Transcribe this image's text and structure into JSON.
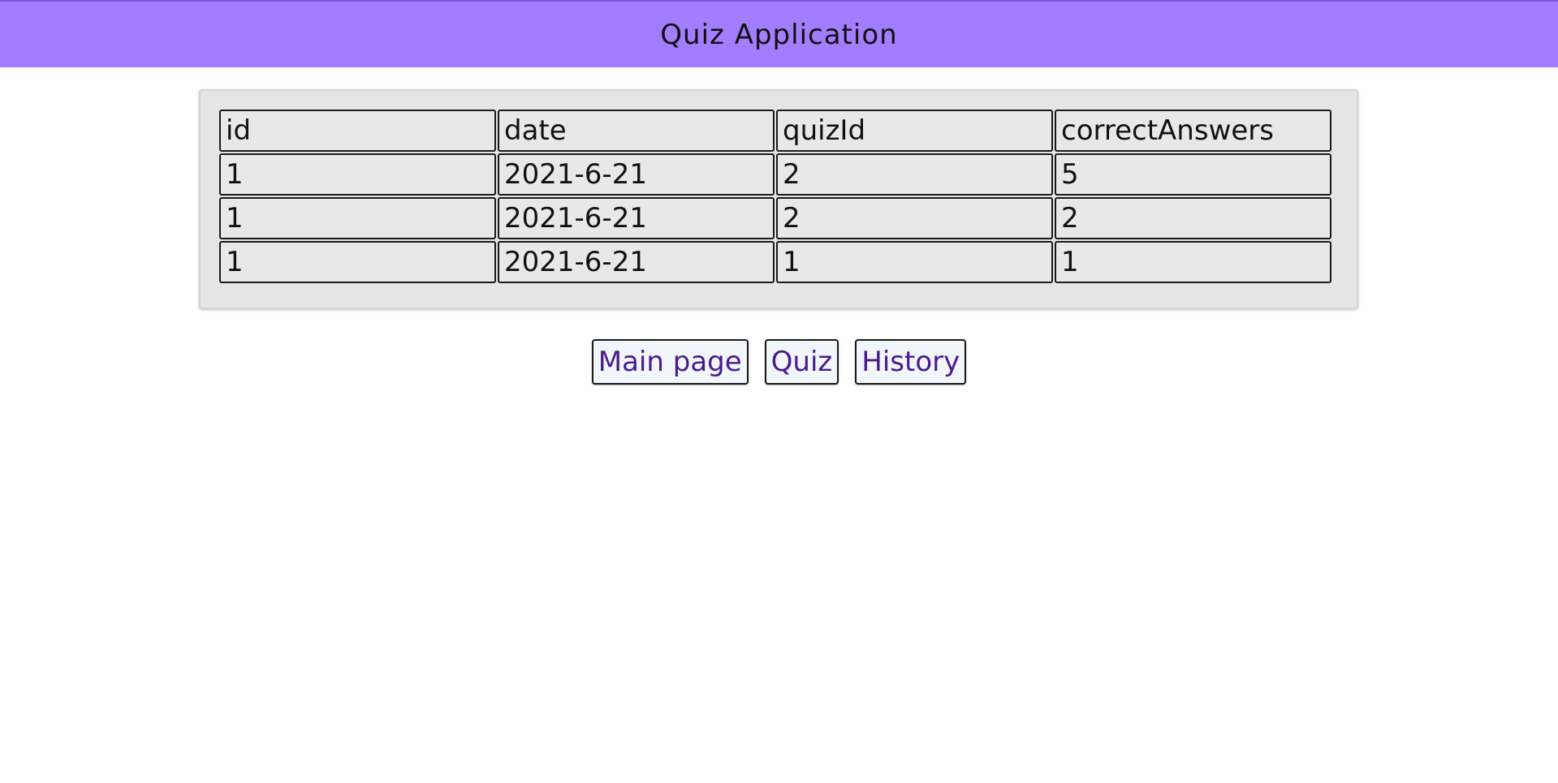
{
  "header": {
    "title": "Quiz Application"
  },
  "history_table": {
    "columns": [
      "id",
      "date",
      "quizId",
      "correctAnswers"
    ],
    "rows": [
      [
        "1",
        "2021-6-21",
        "2",
        "5"
      ],
      [
        "1",
        "2021-6-21",
        "2",
        "2"
      ],
      [
        "1",
        "2021-6-21",
        "1",
        "1"
      ]
    ]
  },
  "nav": {
    "buttons": [
      "Main page",
      "Quiz",
      "History"
    ]
  },
  "colors": {
    "header_bg": "#a37dff",
    "button_text": "#4a1a8c",
    "cell_bg": "#e8e8e8"
  }
}
